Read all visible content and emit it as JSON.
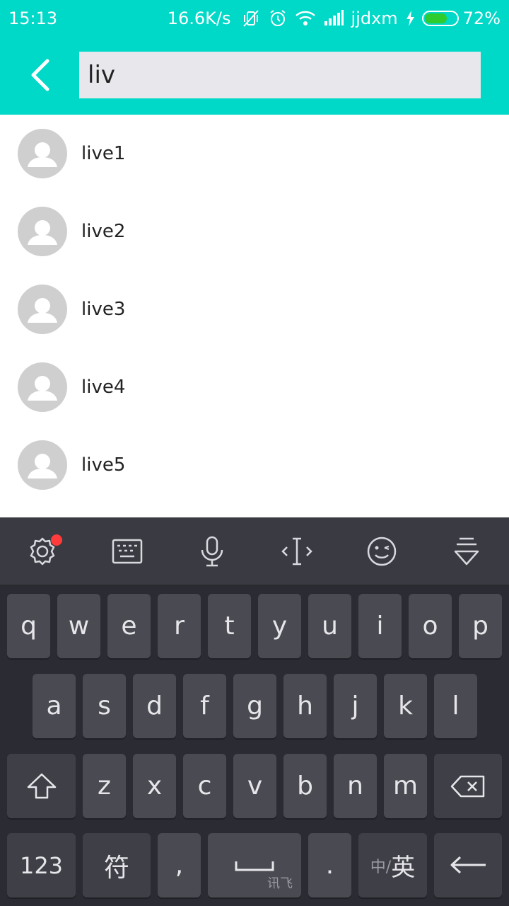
{
  "status": {
    "time": "15:13",
    "speed": "16.6K/s",
    "carrier": "jjdxm",
    "battery": "72%",
    "battery_level": 0.72,
    "icons": [
      "vibrate-off-icon",
      "alarm-icon",
      "wifi-icon",
      "signal-icon",
      "charging-icon",
      "battery-icon"
    ]
  },
  "search": {
    "value": "liv"
  },
  "results": [
    {
      "label": "live1"
    },
    {
      "label": "live2"
    },
    {
      "label": "live3"
    },
    {
      "label": "live4"
    },
    {
      "label": "live5"
    }
  ],
  "keyboard": {
    "toolbar_icons": [
      "settings-icon",
      "keyboard-icon",
      "microphone-icon",
      "cursor-icon",
      "emoji-icon",
      "hide-keyboard-icon"
    ],
    "row1": [
      "q",
      "w",
      "e",
      "r",
      "t",
      "y",
      "u",
      "i",
      "o",
      "p"
    ],
    "row2": [
      "a",
      "s",
      "d",
      "f",
      "g",
      "h",
      "j",
      "k",
      "l"
    ],
    "row3": [
      "z",
      "x",
      "c",
      "v",
      "b",
      "n",
      "m"
    ],
    "num_label": "123",
    "symbol_label": "符",
    "comma_label": ",",
    "space_sub": "讯飞",
    "period_label": ".",
    "lang_small": "中/",
    "lang_main": "英"
  },
  "colors": {
    "accent": "#00d8c8",
    "keyboard_bg": "#2b2b33",
    "key_bg": "#4a4a52",
    "badge": "#ff3b3b",
    "battery_fill": "#2ecc2e"
  }
}
